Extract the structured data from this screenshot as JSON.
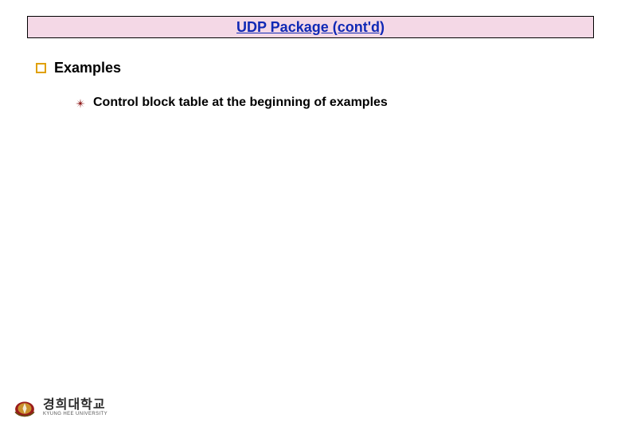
{
  "title": "UDP Package (cont'd)",
  "section": "Examples",
  "subitem": "Control block table at the beginning of examples",
  "logo": {
    "name_kr": "경희대학교",
    "name_en": "KYUNG HEE UNIVERSITY"
  }
}
